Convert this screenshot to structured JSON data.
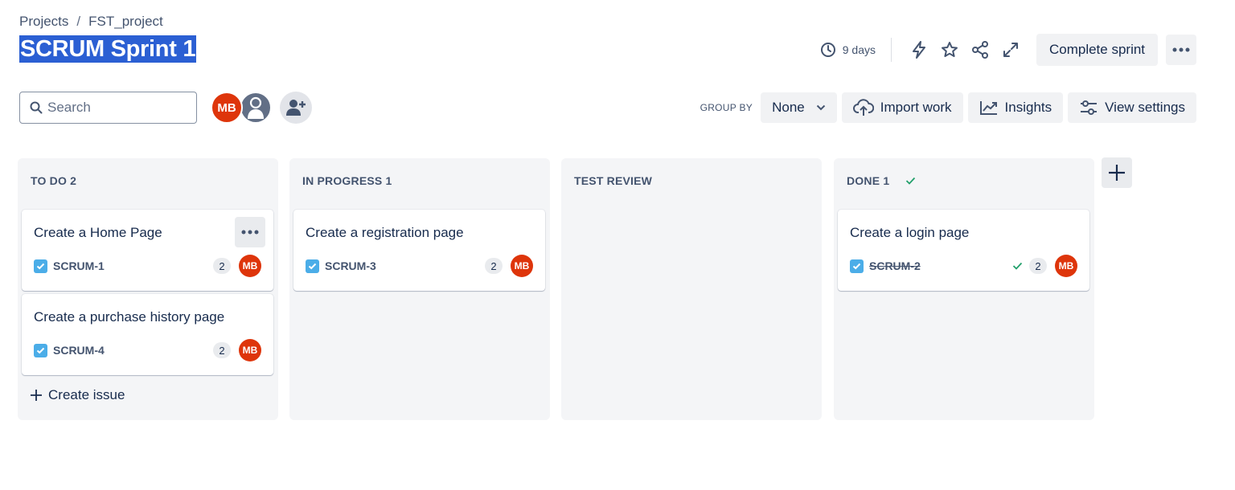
{
  "breadcrumb": {
    "projects": "Projects",
    "separator": "/",
    "project": "FST_project"
  },
  "title": "SCRUM Sprint 1",
  "header": {
    "days": "9 days",
    "complete_sprint": "Complete sprint"
  },
  "search": {
    "placeholder": "Search",
    "value": ""
  },
  "avatars": {
    "user_initials": "MB"
  },
  "toolbar": {
    "group_by_label": "GROUP BY",
    "group_by_value": "None",
    "import_work": "Import work",
    "insights": "Insights",
    "view_settings": "View settings"
  },
  "columns": [
    {
      "header": "TO DO 2",
      "cards": [
        {
          "title": "Create a Home Page",
          "key": "SCRUM-1",
          "points": "2",
          "assignee": "MB"
        },
        {
          "title": "Create a purchase history page",
          "key": "SCRUM-4",
          "points": "2",
          "assignee": "MB"
        }
      ],
      "create_issue": "Create issue"
    },
    {
      "header": "IN PROGRESS 1",
      "cards": [
        {
          "title": "Create a registration page",
          "key": "SCRUM-3",
          "points": "2",
          "assignee": "MB"
        }
      ]
    },
    {
      "header": "TEST REVIEW",
      "cards": []
    },
    {
      "header": "DONE 1",
      "cards": [
        {
          "title": "Create a login page",
          "key": "SCRUM-2",
          "points": "2",
          "assignee": "MB"
        }
      ]
    }
  ],
  "colors": {
    "title_highlight": "#2b5fd3",
    "avatar": "#de350b",
    "task_icon": "#4bade8",
    "done_check": "#22a06b",
    "column_bg": "#f4f5f7"
  },
  "icons": [
    "clock-icon",
    "lightning-icon",
    "star-icon",
    "share-icon",
    "expand-icon",
    "more-icon",
    "search-icon",
    "person-icon",
    "add-person-icon",
    "chevron-down-icon",
    "cloud-upload-icon",
    "insights-icon",
    "settings-icon",
    "check-icon",
    "task-icon",
    "plus-icon"
  ]
}
